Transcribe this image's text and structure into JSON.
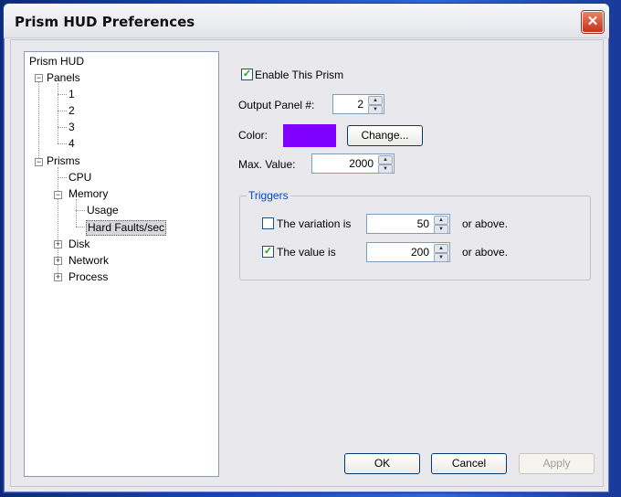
{
  "window": {
    "title": "Prism HUD Preferences"
  },
  "tree": {
    "root": "Prism HUD",
    "panels": {
      "label": "Panels",
      "children": [
        "1",
        "2",
        "3",
        "4"
      ]
    },
    "prisms": {
      "label": "Prisms",
      "cpu": "CPU",
      "memory": {
        "label": "Memory",
        "children": [
          "Usage",
          "Hard Faults/sec"
        ]
      },
      "disk": "Disk",
      "network": "Network",
      "process": "Process"
    }
  },
  "settings": {
    "enable_label": "Enable This Prism",
    "enable_checked": true,
    "output_panel_label": "Output Panel #:",
    "output_panel_value": "2",
    "color_label": "Color:",
    "color_value": "#8000ff",
    "change_button": "Change...",
    "max_value_label": "Max. Value:",
    "max_value": "2000"
  },
  "triggers": {
    "legend": "Triggers",
    "variation_label": "The variation is",
    "variation_checked": false,
    "variation_value": "50",
    "value_label": "The value is",
    "value_checked": true,
    "value_value": "200",
    "suffix": "or above."
  },
  "buttons": {
    "ok": "OK",
    "cancel": "Cancel",
    "apply": "Apply"
  }
}
